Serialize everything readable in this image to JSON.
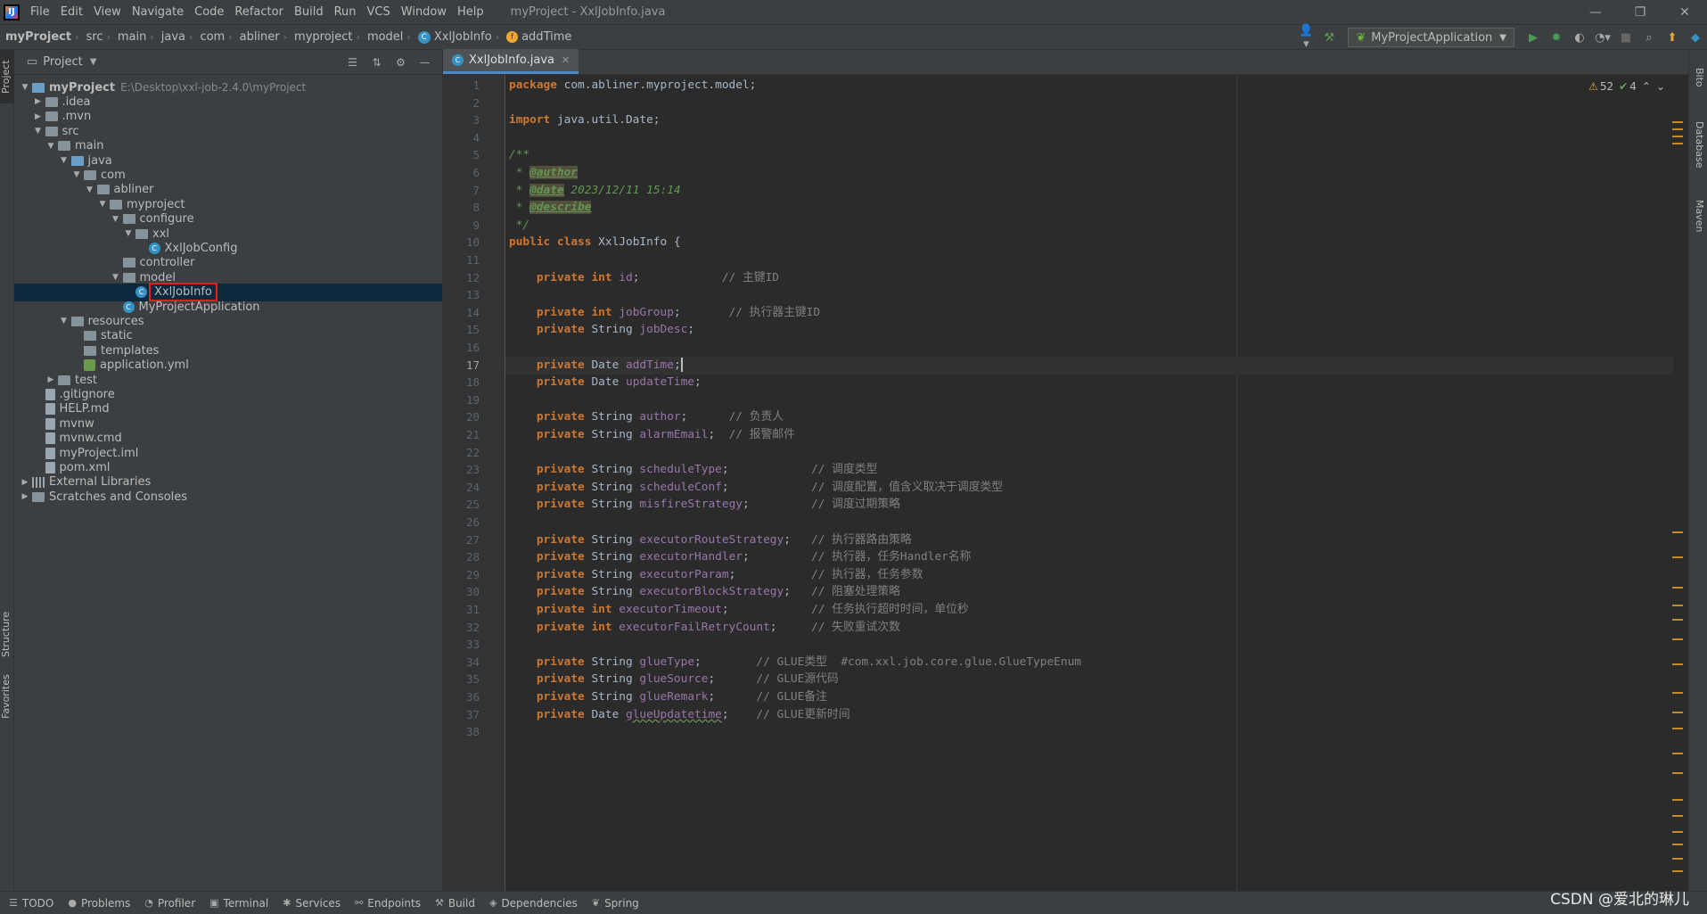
{
  "window": {
    "menu": [
      "File",
      "Edit",
      "View",
      "Navigate",
      "Code",
      "Refactor",
      "Build",
      "Run",
      "VCS",
      "Window",
      "Help"
    ],
    "title": "myProject - XxlJobInfo.java"
  },
  "breadcrumb": {
    "items": [
      "myProject",
      "src",
      "main",
      "java",
      "com",
      "abliner",
      "myproject",
      "model"
    ],
    "class_name": "XxlJobInfo",
    "member_name": "addTime"
  },
  "toolbar": {
    "run_config": "MyProjectApplication"
  },
  "project_panel": {
    "title": "Project",
    "tree": [
      {
        "label": "myProject",
        "path": "E:\\Desktop\\xxl-job-2.4.0\\myProject",
        "depth": 0,
        "arrow": "down",
        "icon": "folder-blue",
        "bold": true
      },
      {
        "label": ".idea",
        "depth": 1,
        "arrow": "right",
        "icon": "folder"
      },
      {
        "label": ".mvn",
        "depth": 1,
        "arrow": "right",
        "icon": "folder"
      },
      {
        "label": "src",
        "depth": 1,
        "arrow": "down",
        "icon": "folder"
      },
      {
        "label": "main",
        "depth": 2,
        "arrow": "down",
        "icon": "folder"
      },
      {
        "label": "java",
        "depth": 3,
        "arrow": "down",
        "icon": "folder-blue"
      },
      {
        "label": "com",
        "depth": 4,
        "arrow": "down",
        "icon": "folder"
      },
      {
        "label": "abliner",
        "depth": 5,
        "arrow": "down",
        "icon": "folder"
      },
      {
        "label": "myproject",
        "depth": 6,
        "arrow": "down",
        "icon": "folder"
      },
      {
        "label": "configure",
        "depth": 7,
        "arrow": "down",
        "icon": "folder"
      },
      {
        "label": "xxl",
        "depth": 8,
        "arrow": "down",
        "icon": "folder"
      },
      {
        "label": "XxlJobConfig",
        "depth": 9,
        "arrow": "",
        "icon": "class"
      },
      {
        "label": "controller",
        "depth": 7,
        "arrow": "",
        "icon": "folder"
      },
      {
        "label": "model",
        "depth": 7,
        "arrow": "down",
        "icon": "folder"
      },
      {
        "label": "XxlJobInfo",
        "depth": 8,
        "arrow": "",
        "icon": "class",
        "selected": true
      },
      {
        "label": "MyProjectApplication",
        "depth": 7,
        "arrow": "",
        "icon": "class"
      },
      {
        "label": "resources",
        "depth": 3,
        "arrow": "down",
        "icon": "folder"
      },
      {
        "label": "static",
        "depth": 4,
        "arrow": "",
        "icon": "folder"
      },
      {
        "label": "templates",
        "depth": 4,
        "arrow": "",
        "icon": "folder"
      },
      {
        "label": "application.yml",
        "depth": 4,
        "arrow": "",
        "icon": "yml"
      },
      {
        "label": "test",
        "depth": 2,
        "arrow": "right",
        "icon": "folder"
      },
      {
        "label": ".gitignore",
        "depth": 1,
        "arrow": "",
        "icon": "file"
      },
      {
        "label": "HELP.md",
        "depth": 1,
        "arrow": "",
        "icon": "file"
      },
      {
        "label": "mvnw",
        "depth": 1,
        "arrow": "",
        "icon": "file"
      },
      {
        "label": "mvnw.cmd",
        "depth": 1,
        "arrow": "",
        "icon": "file"
      },
      {
        "label": "myProject.iml",
        "depth": 1,
        "arrow": "",
        "icon": "file"
      },
      {
        "label": "pom.xml",
        "depth": 1,
        "arrow": "",
        "icon": "file"
      },
      {
        "label": "External Libraries",
        "depth": 0,
        "arrow": "right",
        "icon": "lib"
      },
      {
        "label": "Scratches and Consoles",
        "depth": 0,
        "arrow": "right",
        "icon": "folder"
      }
    ]
  },
  "left_strip": [
    "Project",
    "Structure",
    "Favorites"
  ],
  "right_strip": [
    "Bito",
    "Database",
    "Maven"
  ],
  "editor": {
    "tab_label": "XxlJobInfo.java",
    "warnings": "52",
    "ok_count": "4",
    "current_line": 17,
    "lines": [
      {
        "n": 1,
        "t": [
          [
            "kw",
            "package "
          ],
          [
            "",
            "com.abliner.myproject.model;"
          ]
        ]
      },
      {
        "n": 2,
        "t": []
      },
      {
        "n": 3,
        "t": [
          [
            "kw",
            "import "
          ],
          [
            "",
            "java.util.Date;"
          ]
        ]
      },
      {
        "n": 4,
        "t": []
      },
      {
        "n": 5,
        "t": [
          [
            "doc",
            "/**"
          ]
        ]
      },
      {
        "n": 6,
        "t": [
          [
            "doc",
            " * "
          ],
          [
            "tag",
            "@author"
          ]
        ]
      },
      {
        "n": 7,
        "t": [
          [
            "doc",
            " * "
          ],
          [
            "tag",
            "@date"
          ],
          [
            "doc",
            " 2023/12/11 15:14"
          ]
        ]
      },
      {
        "n": 8,
        "t": [
          [
            "doc",
            " * "
          ],
          [
            "tag",
            "@describe"
          ]
        ]
      },
      {
        "n": 9,
        "t": [
          [
            "doc",
            " */"
          ]
        ]
      },
      {
        "n": 10,
        "t": [
          [
            "kw",
            "public class "
          ],
          [
            "",
            "XxlJobInfo {"
          ]
        ]
      },
      {
        "n": 11,
        "t": []
      },
      {
        "n": 12,
        "t": [
          [
            "",
            "    "
          ],
          [
            "kw",
            "private int "
          ],
          [
            "fld",
            "id"
          ],
          [
            "",
            ";            "
          ],
          [
            "cmt",
            "// 主键ID"
          ]
        ]
      },
      {
        "n": 13,
        "t": []
      },
      {
        "n": 14,
        "t": [
          [
            "",
            "    "
          ],
          [
            "kw",
            "private int "
          ],
          [
            "fld",
            "jobGroup"
          ],
          [
            "",
            ";       "
          ],
          [
            "cmt",
            "// 执行器主键ID"
          ]
        ]
      },
      {
        "n": 15,
        "t": [
          [
            "",
            "    "
          ],
          [
            "kw",
            "private "
          ],
          [
            "",
            "String "
          ],
          [
            "fld",
            "jobDesc"
          ],
          [
            "",
            ";"
          ]
        ]
      },
      {
        "n": 16,
        "t": []
      },
      {
        "n": 17,
        "t": [
          [
            "",
            "    "
          ],
          [
            "kw",
            "private "
          ],
          [
            "",
            "Date "
          ],
          [
            "fld",
            "addTime"
          ],
          [
            "",
            ";"
          ],
          [
            "caret",
            ""
          ]
        ]
      },
      {
        "n": 18,
        "t": [
          [
            "",
            "    "
          ],
          [
            "kw",
            "private "
          ],
          [
            "",
            "Date "
          ],
          [
            "fld",
            "updateTime"
          ],
          [
            "",
            ";"
          ]
        ]
      },
      {
        "n": 19,
        "t": []
      },
      {
        "n": 20,
        "t": [
          [
            "",
            "    "
          ],
          [
            "kw",
            "private "
          ],
          [
            "",
            "String "
          ],
          [
            "fld",
            "author"
          ],
          [
            "",
            ";      "
          ],
          [
            "cmt",
            "// 负责人"
          ]
        ]
      },
      {
        "n": 21,
        "t": [
          [
            "",
            "    "
          ],
          [
            "kw",
            "private "
          ],
          [
            "",
            "String "
          ],
          [
            "fld",
            "alarmEmail"
          ],
          [
            "",
            ";  "
          ],
          [
            "cmt",
            "// 报警邮件"
          ]
        ]
      },
      {
        "n": 22,
        "t": []
      },
      {
        "n": 23,
        "t": [
          [
            "",
            "    "
          ],
          [
            "kw",
            "private "
          ],
          [
            "",
            "String "
          ],
          [
            "fld",
            "scheduleType"
          ],
          [
            "",
            ";            "
          ],
          [
            "cmt",
            "// 调度类型"
          ]
        ]
      },
      {
        "n": 24,
        "t": [
          [
            "",
            "    "
          ],
          [
            "kw",
            "private "
          ],
          [
            "",
            "String "
          ],
          [
            "fld",
            "scheduleConf"
          ],
          [
            "",
            ";            "
          ],
          [
            "cmt",
            "// 调度配置，值含义取决于调度类型"
          ]
        ]
      },
      {
        "n": 25,
        "t": [
          [
            "",
            "    "
          ],
          [
            "kw",
            "private "
          ],
          [
            "",
            "String "
          ],
          [
            "fld",
            "misfireStrategy"
          ],
          [
            "",
            ";         "
          ],
          [
            "cmt",
            "// 调度过期策略"
          ]
        ]
      },
      {
        "n": 26,
        "t": []
      },
      {
        "n": 27,
        "t": [
          [
            "",
            "    "
          ],
          [
            "kw",
            "private "
          ],
          [
            "",
            "String "
          ],
          [
            "fld",
            "executorRouteStrategy"
          ],
          [
            "",
            ";   "
          ],
          [
            "cmt",
            "// 执行器路由策略"
          ]
        ]
      },
      {
        "n": 28,
        "t": [
          [
            "",
            "    "
          ],
          [
            "kw",
            "private "
          ],
          [
            "",
            "String "
          ],
          [
            "fld",
            "executorHandler"
          ],
          [
            "",
            ";         "
          ],
          [
            "cmt",
            "// 执行器，任务Handler名称"
          ]
        ]
      },
      {
        "n": 29,
        "t": [
          [
            "",
            "    "
          ],
          [
            "kw",
            "private "
          ],
          [
            "",
            "String "
          ],
          [
            "fld",
            "executorParam"
          ],
          [
            "",
            ";           "
          ],
          [
            "cmt",
            "// 执行器，任务参数"
          ]
        ]
      },
      {
        "n": 30,
        "t": [
          [
            "",
            "    "
          ],
          [
            "kw",
            "private "
          ],
          [
            "",
            "String "
          ],
          [
            "fld",
            "executorBlockStrategy"
          ],
          [
            "",
            ";   "
          ],
          [
            "cmt",
            "// 阻塞处理策略"
          ]
        ]
      },
      {
        "n": 31,
        "t": [
          [
            "",
            "    "
          ],
          [
            "kw",
            "private int "
          ],
          [
            "fld",
            "executorTimeout"
          ],
          [
            "",
            ";            "
          ],
          [
            "cmt",
            "// 任务执行超时时间，单位秒"
          ]
        ]
      },
      {
        "n": 32,
        "t": [
          [
            "",
            "    "
          ],
          [
            "kw",
            "private int "
          ],
          [
            "fld",
            "executorFailRetryCount"
          ],
          [
            "",
            ";     "
          ],
          [
            "cmt",
            "// 失败重试次数"
          ]
        ]
      },
      {
        "n": 33,
        "t": []
      },
      {
        "n": 34,
        "t": [
          [
            "",
            "    "
          ],
          [
            "kw",
            "private "
          ],
          [
            "",
            "String "
          ],
          [
            "fld",
            "glueType"
          ],
          [
            "",
            ";        "
          ],
          [
            "cmt",
            "// GLUE类型  #com.xxl.job.core.glue.GlueTypeEnum"
          ]
        ]
      },
      {
        "n": 35,
        "t": [
          [
            "",
            "    "
          ],
          [
            "kw",
            "private "
          ],
          [
            "",
            "String "
          ],
          [
            "fld",
            "glueSource"
          ],
          [
            "",
            ";      "
          ],
          [
            "cmt",
            "// GLUE源代码"
          ]
        ]
      },
      {
        "n": 36,
        "t": [
          [
            "",
            "    "
          ],
          [
            "kw",
            "private "
          ],
          [
            "",
            "String "
          ],
          [
            "fld",
            "glueRemark"
          ],
          [
            "",
            ";      "
          ],
          [
            "cmt",
            "// GLUE备注"
          ]
        ]
      },
      {
        "n": 37,
        "t": [
          [
            "",
            "    "
          ],
          [
            "kw",
            "private "
          ],
          [
            "",
            "Date "
          ],
          [
            "fldu",
            "glueUpdatetime"
          ],
          [
            "",
            ";    "
          ],
          [
            "cmt",
            "// GLUE更新时间"
          ]
        ]
      },
      {
        "n": 38,
        "t": []
      }
    ]
  },
  "statusbar": {
    "items": [
      {
        "icon": "todo-icon",
        "glyph": "☰",
        "label": "TODO"
      },
      {
        "icon": "problems-icon",
        "glyph": "●",
        "label": "Problems"
      },
      {
        "icon": "profiler-icon",
        "glyph": "◔",
        "label": "Profiler"
      },
      {
        "icon": "terminal-icon",
        "glyph": "▣",
        "label": "Terminal"
      },
      {
        "icon": "services-icon",
        "glyph": "✱",
        "label": "Services"
      },
      {
        "icon": "endpoints-icon",
        "glyph": "⚯",
        "label": "Endpoints"
      },
      {
        "icon": "build-icon",
        "glyph": "⚒",
        "label": "Build"
      },
      {
        "icon": "dependencies-icon",
        "glyph": "◈",
        "label": "Dependencies"
      },
      {
        "icon": "spring-icon",
        "glyph": "❦",
        "label": "Spring"
      }
    ]
  },
  "watermark": "CSDN @爱北的琳儿"
}
